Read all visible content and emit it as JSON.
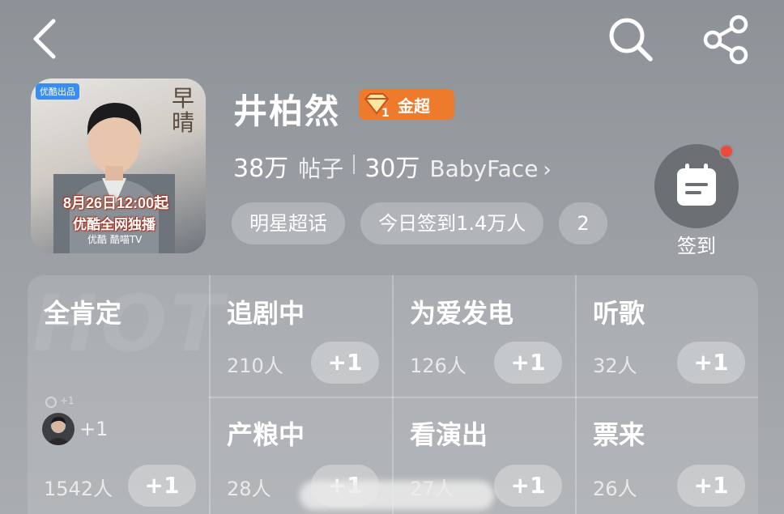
{
  "header": {
    "back_icon": "chevron-left-icon",
    "search_icon": "search-icon",
    "share_icon": "share-icon"
  },
  "poster": {
    "tag": "优酷出品",
    "calligraphy": "早晴",
    "date": "8月26日12:00起",
    "broadcast": "优酷全网独播",
    "logos": "优酷  酷喵TV"
  },
  "profile": {
    "name": "井柏然",
    "badge_label": "金超",
    "badge_level": "1",
    "posts_count": "38万",
    "posts_label": "帖子",
    "fans_count": "30万",
    "fans_label": "BabyFace",
    "fans_chevron": "›"
  },
  "chips": [
    {
      "label": "明星超话"
    },
    {
      "label": "今日签到1.4万人"
    },
    {
      "label": "2"
    }
  ],
  "checkin": {
    "label": "签到",
    "icon": "calendar-icon",
    "has_notification": true
  },
  "grid": {
    "watermark": "HOT",
    "plus_label": "+1",
    "featured": {
      "title": "全肯定",
      "count": "1542人",
      "avatar_plus": "+1",
      "tiny_plus": "+1"
    },
    "cells": [
      {
        "title": "追剧中",
        "count": "210人"
      },
      {
        "title": "为爱发电",
        "count": "126人"
      },
      {
        "title": "听歌",
        "count": "32人"
      },
      {
        "title": "产粮中",
        "count": "28人"
      },
      {
        "title": "看演出",
        "count": "27人"
      },
      {
        "title": "票来",
        "count": "26人"
      }
    ]
  },
  "colors": {
    "badge_orange": "#ee7a2b",
    "notification_red": "#ee4a3a",
    "poster_text_red": "#b33a23"
  }
}
